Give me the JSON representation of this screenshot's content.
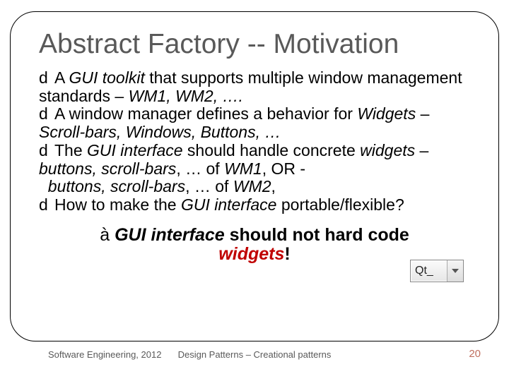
{
  "title": "Abstract Factory -- Motivation",
  "bullet_glyph": "d",
  "dash_glyph": "–",
  "bullets": {
    "b1": {
      "pre": "A ",
      "em1": "GUI toolkit",
      "mid": " that supports multiple window management standards ",
      "em2": "WM1, WM2, …."
    },
    "b2": {
      "pre": "A window manager defines a behavior for ",
      "em1": "Widgets",
      "mid": " ",
      "em2": "Scroll-bars, Windows, Buttons, …"
    },
    "b3": {
      "pre": "The ",
      "em1": "GUI interface",
      "mid": " should handle concrete ",
      "em2": "widgets",
      "mid2": " ",
      "em3": "buttons, scroll-bars",
      "mid3": ", … of ",
      "em4": "WM1",
      "tail": ",   OR -",
      "line2_em": "buttons, scroll-bars",
      "line2_mid": ", … of ",
      "line2_em2": "WM2",
      "line2_tail": ","
    },
    "b4": {
      "pre": "How to make the ",
      "em1": "GUI interface",
      "tail": " portable/flexible?"
    }
  },
  "conclusion": {
    "arrow": "à",
    "em": "GUI interface ",
    "bold": "should not hard code ",
    "widgets": "widgets",
    "bang": "!"
  },
  "dropdown": {
    "label": "Qt_"
  },
  "footer": {
    "left": "Software Engineering, 2012",
    "center": "Design Patterns – Creational patterns",
    "page": "20"
  }
}
